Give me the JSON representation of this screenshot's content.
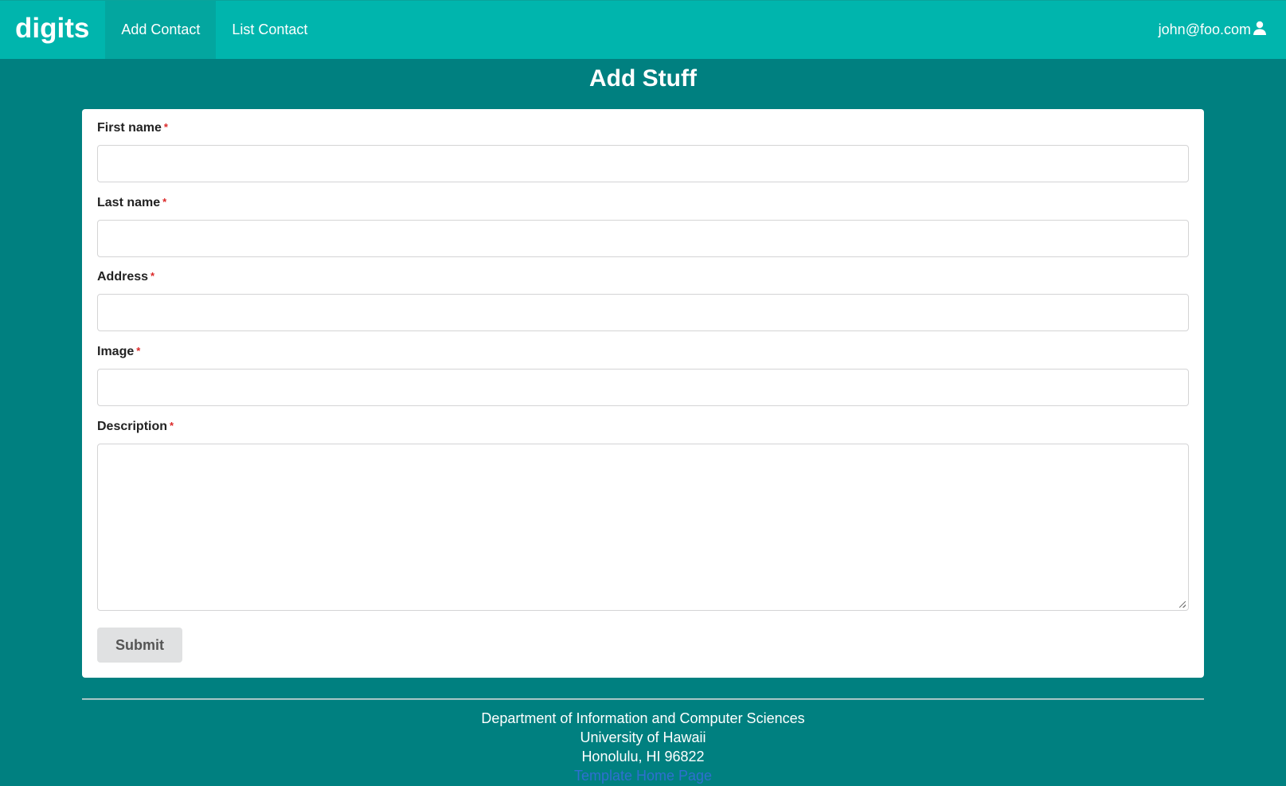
{
  "navbar": {
    "brand": "digits",
    "items": [
      {
        "label": "Add Contact",
        "active": true
      },
      {
        "label": "List Contact",
        "active": false
      }
    ],
    "user_email": "john@foo.com",
    "user_icon": "user-icon",
    "color": "#00b5ad"
  },
  "page": {
    "title": "Add Stuff",
    "background": "#008080"
  },
  "form": {
    "fields": [
      {
        "label": "First name",
        "required_mark": "*",
        "value": ""
      },
      {
        "label": "Last name",
        "required_mark": "*",
        "value": ""
      },
      {
        "label": "Address",
        "required_mark": "*",
        "value": ""
      },
      {
        "label": "Image",
        "required_mark": "*",
        "value": ""
      },
      {
        "label": "Description",
        "required_mark": "*",
        "value": ""
      }
    ],
    "submit_label": "Submit"
  },
  "footer": {
    "line1": "Department of Information and Computer Sciences",
    "line2": "University of Hawaii",
    "line3": "Honolulu, HI 96822",
    "link": "Template Home Page"
  }
}
